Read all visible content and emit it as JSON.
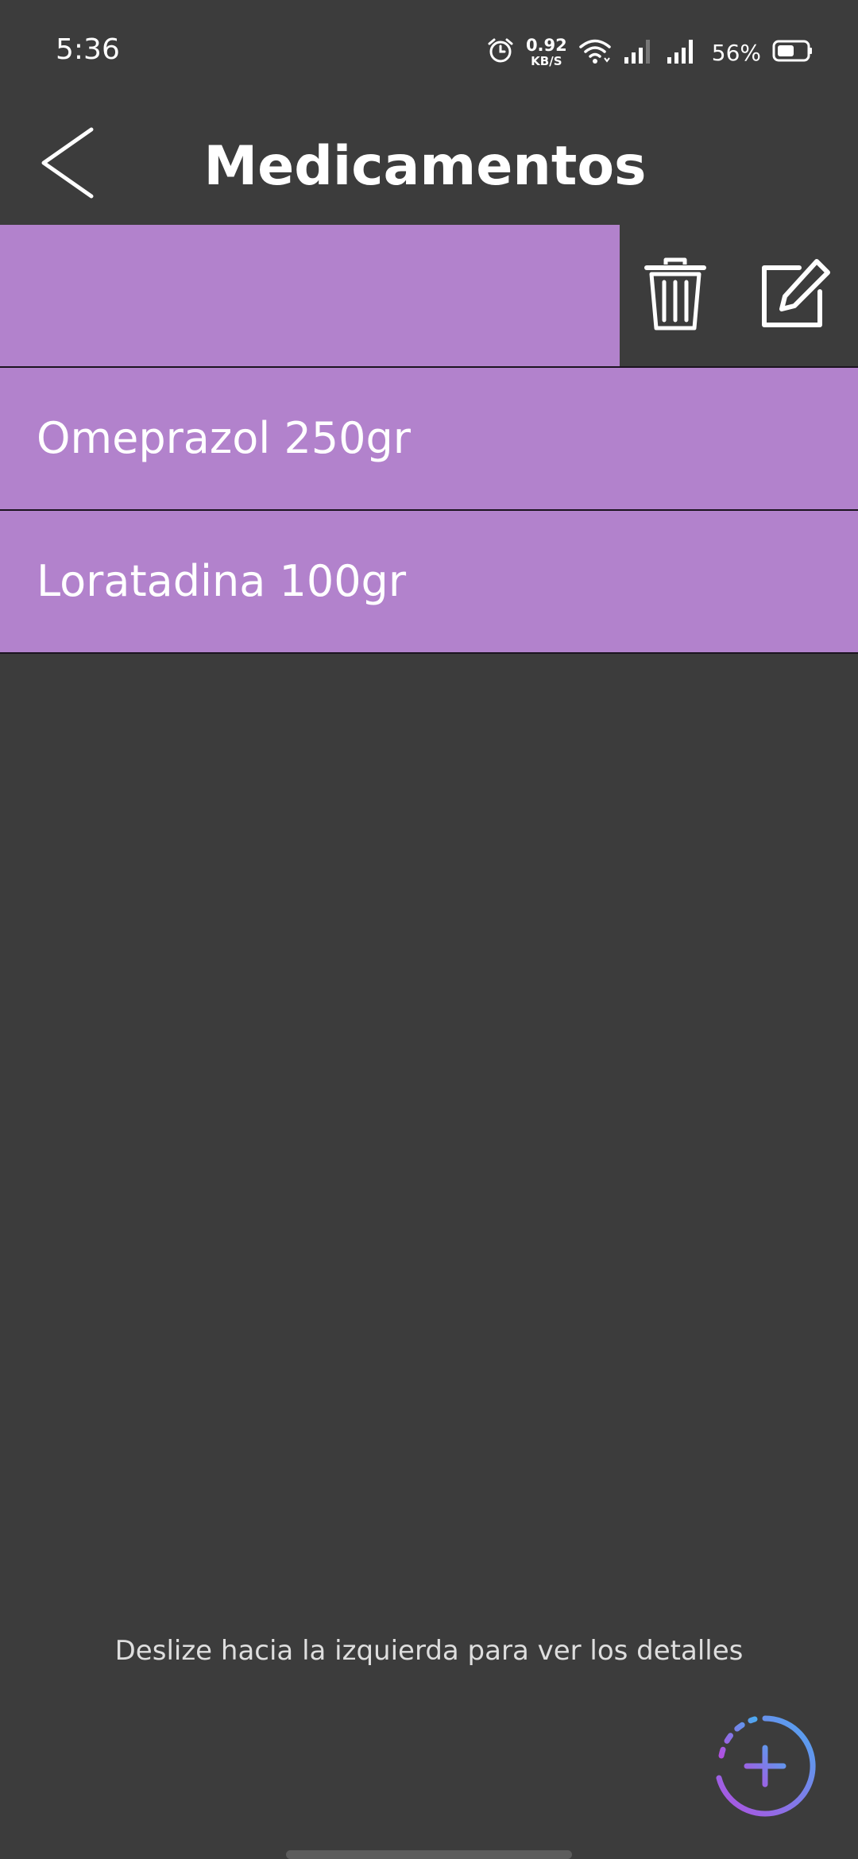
{
  "status_bar": {
    "time": "5:36",
    "net_speed_value": "0.92",
    "net_speed_unit": "KB/S",
    "battery_percent": "56%",
    "icons": [
      "alarm-icon",
      "wifi-icon",
      "signal-icon",
      "signal-icon",
      "battery-icon"
    ]
  },
  "header": {
    "title": "Medicamentos",
    "back_icon": "chevron-left-icon"
  },
  "list": {
    "items": [
      {
        "label": "",
        "swiped": true,
        "actions": [
          "trash-icon",
          "edit-icon"
        ]
      },
      {
        "label": "Omeprazol 250gr"
      },
      {
        "label": "Loratadina 100gr"
      }
    ]
  },
  "footer": {
    "hint": "Deslize hacia la izquierda para ver los detalles",
    "fab_icon": "add-icon"
  },
  "colors": {
    "background": "#3c3c3c",
    "row": "#b282cc",
    "fab_gradient_start": "#b050e0",
    "fab_gradient_end": "#4ea8f0"
  }
}
